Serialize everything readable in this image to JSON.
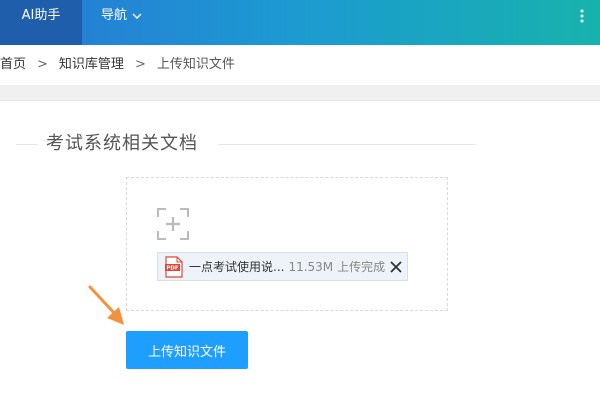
{
  "topnav": {
    "active_tab": "AI助手",
    "dropdown_label": "导航"
  },
  "breadcrumb": {
    "items": [
      "首页",
      "知识库管理",
      "上传知识文件"
    ],
    "separator": ">"
  },
  "section": {
    "title": "考试系统相关文档"
  },
  "upload": {
    "file": {
      "type_label": "PDF",
      "name": "一点考试使用说...",
      "size": "11.53M",
      "status": "上传完成"
    },
    "button_label": "上传知识文件"
  },
  "colors": {
    "primary_button": "#1e9fff",
    "annotation_arrow": "#f5913c",
    "pdf_red": "#e0453a"
  }
}
